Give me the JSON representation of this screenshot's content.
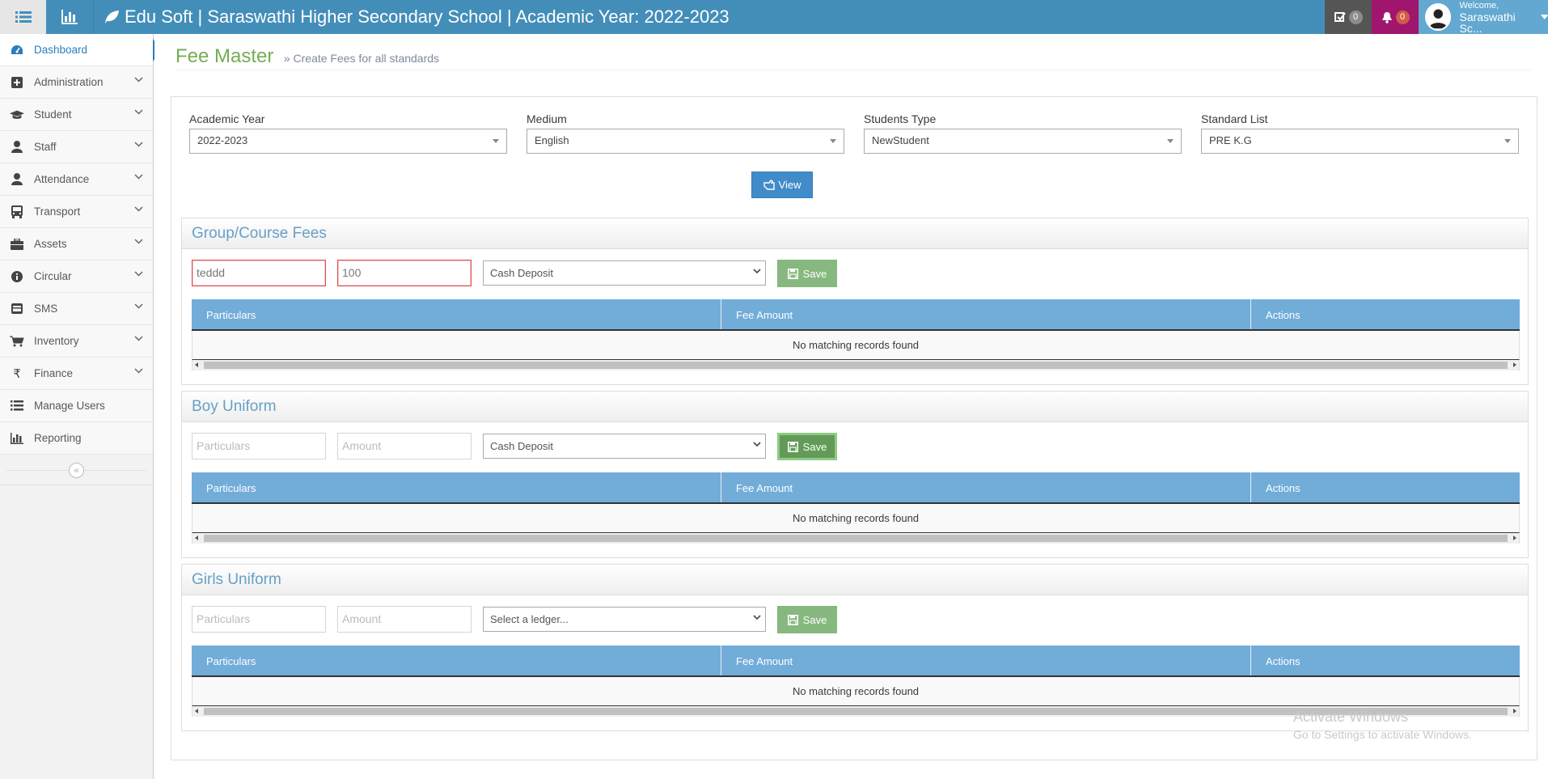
{
  "app": {
    "brand_title": "Edu Soft | Saraswathi Higher Secondary School | Academic Year: 2022-2023",
    "tasks_count": "0",
    "notifications_count": "0",
    "welcome": "Welcome,",
    "user_name": "Saraswathi Sc..."
  },
  "sidebar": {
    "items": [
      {
        "label": "Dashboard",
        "icon": "dashboard-icon"
      },
      {
        "label": "Administration",
        "icon": "plus-square-icon"
      },
      {
        "label": "Student",
        "icon": "graduation-cap-icon"
      },
      {
        "label": "Staff",
        "icon": "user-icon"
      },
      {
        "label": "Attendance",
        "icon": "user-icon"
      },
      {
        "label": "Transport",
        "icon": "bus-icon"
      },
      {
        "label": "Assets",
        "icon": "briefcase-icon"
      },
      {
        "label": "Circular",
        "icon": "info-icon"
      },
      {
        "label": "SMS",
        "icon": "envelope-icon"
      },
      {
        "label": "Inventory",
        "icon": "cart-icon"
      },
      {
        "label": "Finance",
        "icon": "rupee-icon"
      },
      {
        "label": "Manage Users",
        "icon": "list-icon"
      },
      {
        "label": "Reporting",
        "icon": "bar-chart-icon"
      }
    ],
    "collapse_glyph": "«"
  },
  "page": {
    "title": "Fee Master",
    "subtitle": "» Create Fees for all standards"
  },
  "filters": {
    "academic_year_label": "Academic Year",
    "academic_year_value": "2022-2023",
    "medium_label": "Medium",
    "medium_value": "English",
    "students_type_label": "Students Type",
    "students_type_value": "NewStudent",
    "standard_list_label": "Standard List",
    "standard_list_value": "PRE K.G",
    "view_label": "View"
  },
  "sections": [
    {
      "title": "Group/Course Fees",
      "particulars_value": "teddd",
      "amount_value": "100",
      "ledger_value": "Cash Deposit",
      "save_label": "Save"
    },
    {
      "title": "Boy Uniform",
      "particulars_placeholder": "Particulars",
      "amount_placeholder": "Amount",
      "ledger_value": "Cash Deposit",
      "save_label": "Save"
    },
    {
      "title": "Girls Uniform",
      "particulars_placeholder": "Particulars",
      "amount_placeholder": "Amount",
      "ledger_value": "Select a ledger...",
      "save_label": "Save"
    }
  ],
  "table": {
    "columns": [
      "Particulars",
      "Fee Amount",
      "Actions"
    ],
    "empty_message": "No matching records found"
  },
  "watermark": {
    "line1": "Activate Windows",
    "line2": "Go to Settings to activate Windows."
  }
}
